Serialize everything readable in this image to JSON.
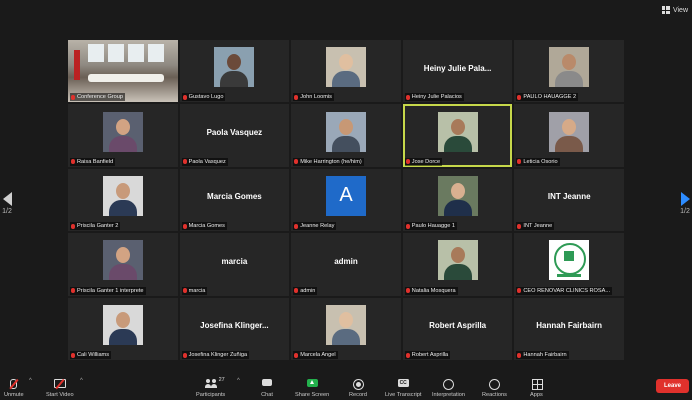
{
  "window": {
    "view_label": "View"
  },
  "pagination": {
    "left": "1/2",
    "right": "1/2"
  },
  "tiles": [
    {
      "name": "Conference Group",
      "display": "photo",
      "bigname": ""
    },
    {
      "name": "Gustavo Lugo",
      "display": "photo",
      "bigname": ""
    },
    {
      "name": "John Loomis",
      "display": "photo",
      "bigname": ""
    },
    {
      "name": "Heiny Julie Palacios",
      "display": "text",
      "bigname": "Heiny Julie Pala..."
    },
    {
      "name": "PAULO HAUAGGE 2",
      "display": "photo",
      "bigname": ""
    },
    {
      "name": "Raisa Banfield",
      "display": "photo",
      "bigname": ""
    },
    {
      "name": "Paola Vasquez",
      "display": "text",
      "bigname": "Paola Vasquez"
    },
    {
      "name": "Mike Harrington (he/him)",
      "display": "photo",
      "bigname": ""
    },
    {
      "name": "Jose Dorce",
      "display": "photo",
      "bigname": ""
    },
    {
      "name": "Leticia Osorio",
      "display": "photo",
      "bigname": ""
    },
    {
      "name": "Priscila Ganter 2",
      "display": "photo",
      "bigname": ""
    },
    {
      "name": "Marcia Gomes",
      "display": "text",
      "bigname": "Marcia Gomes"
    },
    {
      "name": "Jeanne Relay",
      "display": "letter",
      "bigname": "A"
    },
    {
      "name": "Paulo Hauagge 1",
      "display": "photo",
      "bigname": ""
    },
    {
      "name": "INT Jeanne",
      "display": "text",
      "bigname": "INT Jeanne"
    },
    {
      "name": "Priscila Ganter 1 interprete",
      "display": "photo",
      "bigname": ""
    },
    {
      "name": "marcia",
      "display": "text",
      "bigname": "marcia"
    },
    {
      "name": "admin",
      "display": "text",
      "bigname": "admin"
    },
    {
      "name": "Natalia Mosquera",
      "display": "photo",
      "bigname": ""
    },
    {
      "name": "CEO RENOVAR CLINICS ROSA...",
      "display": "logo",
      "bigname": ""
    },
    {
      "name": "Cali Williams",
      "display": "photo",
      "bigname": ""
    },
    {
      "name": "Josefina Klinger Zuñiga",
      "display": "text",
      "bigname": "Josefina Klinger..."
    },
    {
      "name": "Marcela Angel",
      "display": "photo",
      "bigname": ""
    },
    {
      "name": "Robert Asprilla",
      "display": "text",
      "bigname": "Robert Asprilla"
    },
    {
      "name": "Hannah Fairbairn",
      "display": "text",
      "bigname": "Hannah Fairbairn"
    }
  ],
  "toolbar": {
    "unmute": "Unmute",
    "start_video": "Start Video",
    "participants": "Participants",
    "participants_count": "27",
    "chat": "Chat",
    "share_screen": "Share Screen",
    "record": "Record",
    "live_transcript": "Live Transcript",
    "cc": "CC",
    "interpretation": "Interpretation",
    "reactions": "Reactions",
    "apps": "Apps",
    "leave": "Leave",
    "caret": "^"
  },
  "colors": {
    "accent_share": "#23b14d",
    "leave": "#e0312c",
    "speaker_outline": "#c6d84a",
    "nav_next": "#2d8cff"
  }
}
